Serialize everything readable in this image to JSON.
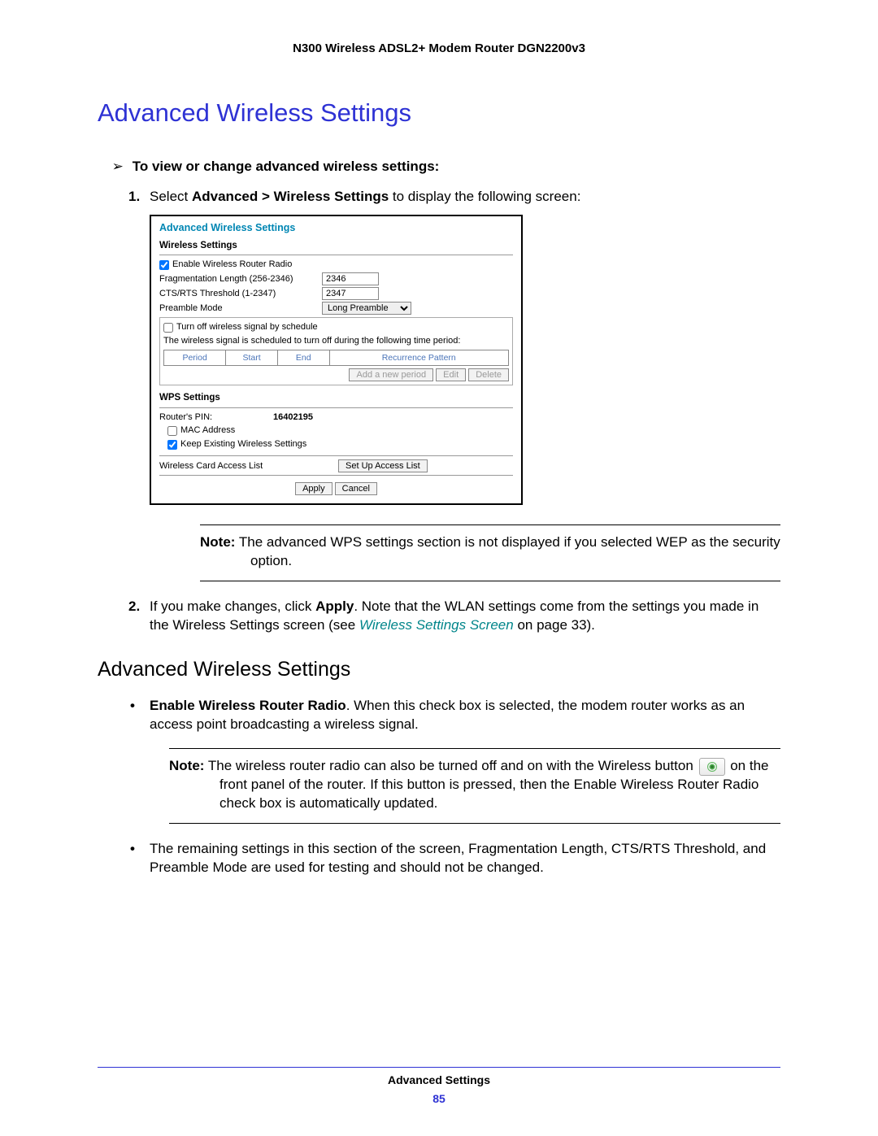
{
  "header": "N300 Wireless ADSL2+ Modem Router DGN2200v3",
  "main_title": "Advanced Wireless Settings",
  "procedure_heading": "To view or change advanced wireless settings:",
  "step1": {
    "number": "1.",
    "pre": "Select ",
    "bold": "Advanced > Wireless Settings",
    "post": " to display the following screen:"
  },
  "panel": {
    "title": "Advanced Wireless Settings",
    "wireless_settings_label": "Wireless Settings",
    "enable_radio_label": "Enable Wireless Router Radio",
    "enable_radio_checked": true,
    "frag_label": "Fragmentation Length (256-2346)",
    "frag_value": "2346",
    "cts_label": "CTS/RTS Threshold (1-2347)",
    "cts_value": "2347",
    "preamble_label": "Preamble Mode",
    "preamble_value": "Long Preamble",
    "schedule_checkbox_label": "Turn off wireless signal by schedule",
    "schedule_checked": false,
    "schedule_note": "The wireless signal is scheduled to turn off during the following time period:",
    "table_headers": [
      "Period",
      "Start",
      "End",
      "Recurrence Pattern"
    ],
    "btn_add_period": "Add a new period",
    "btn_edit": "Edit",
    "btn_delete": "Delete",
    "wps_settings_label": "WPS Settings",
    "routers_pin_label": "Router's PIN:",
    "routers_pin_value": "16402195",
    "mac_address_label": "MAC Address",
    "mac_address_checked": false,
    "keep_existing_label": "Keep Existing Wireless Settings",
    "keep_existing_checked": true,
    "access_list_label": "Wireless Card Access List",
    "btn_access_list": "Set Up Access List",
    "btn_apply": "Apply",
    "btn_cancel": "Cancel"
  },
  "note1": {
    "label": "Note:",
    "text": "  The advanced WPS settings section is not displayed if you selected WEP as the security option."
  },
  "step2": {
    "number": "2.",
    "pre": "If you make changes, click ",
    "bold": "Apply",
    "mid": ". Note that the WLAN settings come from the settings you made in the Wireless Settings screen (see ",
    "link": "Wireless Settings Screen",
    "post": " on page 33)."
  },
  "sub_title": "Advanced Wireless Settings",
  "bullet1": {
    "bold": "Enable Wireless Router Radio",
    "text": ". When this check box is selected, the modem router works as an access point broadcasting a wireless signal."
  },
  "note2": {
    "label": "Note:",
    "text_pre": "  The wireless router radio can also be turned off and on with the Wireless button ",
    "text_post": " on the front panel of the router. If this button is pressed, then the Enable Wireless Router Radio check box is automatically updated."
  },
  "bullet2": "The remaining settings in this section of the screen, Fragmentation Length, CTS/RTS Threshold, and Preamble Mode are used for testing and should not be changed.",
  "footer_title": "Advanced Settings",
  "footer_page": "85"
}
